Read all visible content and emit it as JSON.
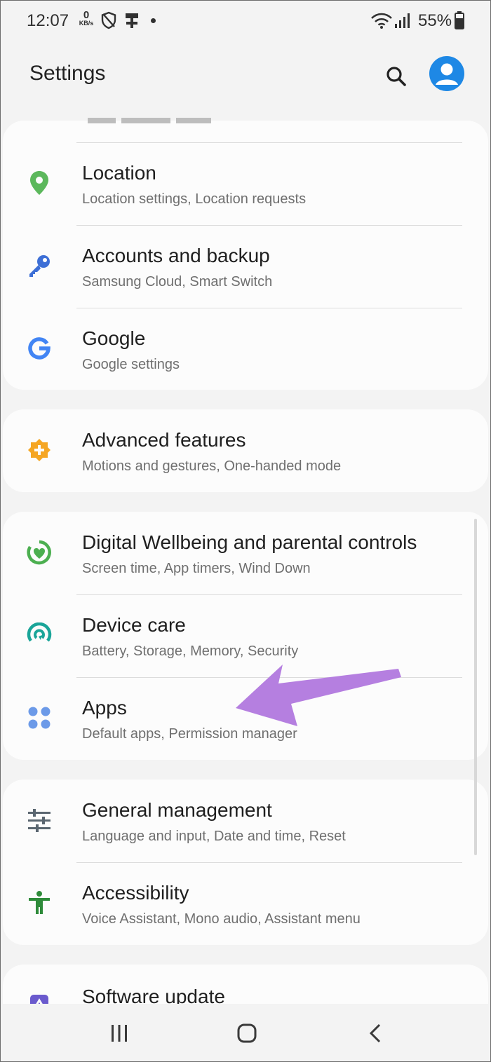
{
  "status_bar": {
    "time": "12:07",
    "net_speed_value": "0",
    "net_speed_unit": "KB/s",
    "battery": "55%"
  },
  "header": {
    "title": "Settings"
  },
  "cards": [
    {
      "items": [
        {
          "title": "Location",
          "subtitle": "Location settings, Location requests",
          "icon": "location-pin-icon",
          "color": "#5cb85c"
        },
        {
          "title": "Accounts and backup",
          "subtitle": "Samsung Cloud, Smart Switch",
          "icon": "key-icon",
          "color": "#3d6fd6"
        },
        {
          "title": "Google",
          "subtitle": "Google settings",
          "icon": "google-g-icon",
          "color": "#4285f4"
        }
      ]
    },
    {
      "items": [
        {
          "title": "Advanced features",
          "subtitle": "Motions and gestures, One-handed mode",
          "icon": "advanced-features-icon",
          "color": "#f5a623"
        }
      ]
    },
    {
      "items": [
        {
          "title": "Digital Wellbeing and parental controls",
          "subtitle": "Screen time, App timers, Wind Down",
          "icon": "wellbeing-heart-icon",
          "color": "#4caf50"
        },
        {
          "title": "Device care",
          "subtitle": "Battery, Storage, Memory, Security",
          "icon": "device-care-icon",
          "color": "#1aa599"
        },
        {
          "title": "Apps",
          "subtitle": "Default apps, Permission manager",
          "icon": "apps-grid-icon",
          "color": "#6c9ae8"
        }
      ]
    },
    {
      "items": [
        {
          "title": "General management",
          "subtitle": "Language and input, Date and time, Reset",
          "icon": "sliders-icon",
          "color": "#5a6670"
        },
        {
          "title": "Accessibility",
          "subtitle": "Voice Assistant, Mono audio, Assistant menu",
          "icon": "accessibility-icon",
          "color": "#2e8b3a"
        }
      ]
    },
    {
      "items": [
        {
          "title": "Software update",
          "icon": "software-update-icon",
          "color": "#6a5acd"
        }
      ]
    }
  ],
  "annotation": {
    "arrow_color": "#b57fe0"
  }
}
